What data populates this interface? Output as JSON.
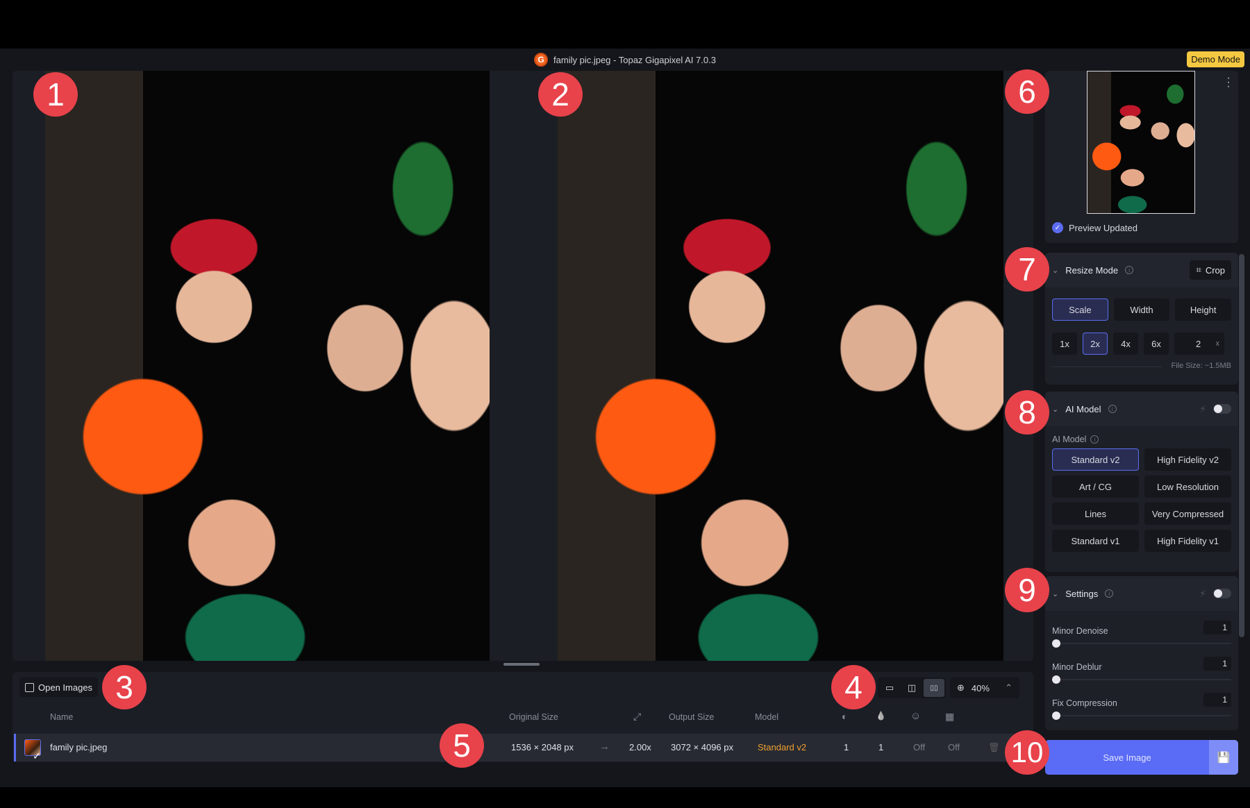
{
  "window": {
    "title": "family pic.jpeg - Topaz Gigapixel AI 7.0.3",
    "logo_glyph": "G",
    "demo_badge": "Demo Mode"
  },
  "annotations": [
    "1",
    "2",
    "3",
    "4",
    "5",
    "6",
    "7",
    "8",
    "9",
    "10"
  ],
  "viewer": {
    "left_pane": "original",
    "right_pane": "enhanced preview",
    "view_modes": [
      {
        "name": "single-view",
        "glyph": "▭",
        "active": false
      },
      {
        "name": "split-view",
        "glyph": "◫",
        "active": false
      },
      {
        "name": "side-by-side",
        "glyph": "▯▯",
        "active": true
      }
    ],
    "zoom_icon": "⊕",
    "zoom_level": "40%",
    "collapse_glyph": "⌃"
  },
  "queue": {
    "open_images_label": "Open Images",
    "columns": {
      "name": "Name",
      "original_size": "Original Size",
      "scale_icon": "⤢",
      "output_size": "Output Size",
      "model": "Model",
      "denoise_icon": "◐",
      "deblur_icon": "💧",
      "face_icon": "☺",
      "compression_icon": "▦"
    },
    "rows": [
      {
        "selected_glyph": "✓",
        "name": "family pic.jpeg",
        "original_size": "1536 × 2048 px",
        "arrow": "→",
        "scale": "2.00x",
        "output_size": "3072 × 4096 px",
        "model": "Standard v2",
        "denoise": "1",
        "deblur": "1",
        "face": "Off",
        "compression": "Off",
        "delete_glyph": "🗑"
      }
    ]
  },
  "sidebar": {
    "preview": {
      "menu_glyph": "⋮",
      "status": "Preview Updated",
      "status_glyph": "✓"
    },
    "resize": {
      "title": "Resize Mode",
      "crop_label": "Crop",
      "crop_glyph": "⌗",
      "modes": [
        {
          "label": "Scale",
          "selected": true
        },
        {
          "label": "Width",
          "selected": false
        },
        {
          "label": "Height",
          "selected": false
        }
      ],
      "scales": [
        {
          "label": "1x",
          "selected": false
        },
        {
          "label": "2x",
          "selected": true
        },
        {
          "label": "4x",
          "selected": false
        },
        {
          "label": "6x",
          "selected": false
        }
      ],
      "custom_value": "2",
      "custom_unit": "x",
      "file_size": "File Size: ~1.5MB"
    },
    "ai_model": {
      "title": "AI Model",
      "field_label": "AI Model",
      "toggle_on": false,
      "models": [
        {
          "label": "Standard v2",
          "selected": true
        },
        {
          "label": "High Fidelity v2",
          "selected": false
        },
        {
          "label": "Art / CG",
          "selected": false
        },
        {
          "label": "Low Resolution",
          "selected": false
        },
        {
          "label": "Lines",
          "selected": false
        },
        {
          "label": "Very Compressed",
          "selected": false
        },
        {
          "label": "Standard v1",
          "selected": false
        },
        {
          "label": "High Fidelity v1",
          "selected": false
        }
      ]
    },
    "settings": {
      "title": "Settings",
      "toggle_on": false,
      "sliders": [
        {
          "label": "Minor Denoise",
          "value": "1"
        },
        {
          "label": "Minor Deblur",
          "value": "1"
        },
        {
          "label": "Fix Compression",
          "value": "1"
        }
      ]
    },
    "save": {
      "label": "Save Image",
      "side_glyph": "💾"
    }
  }
}
